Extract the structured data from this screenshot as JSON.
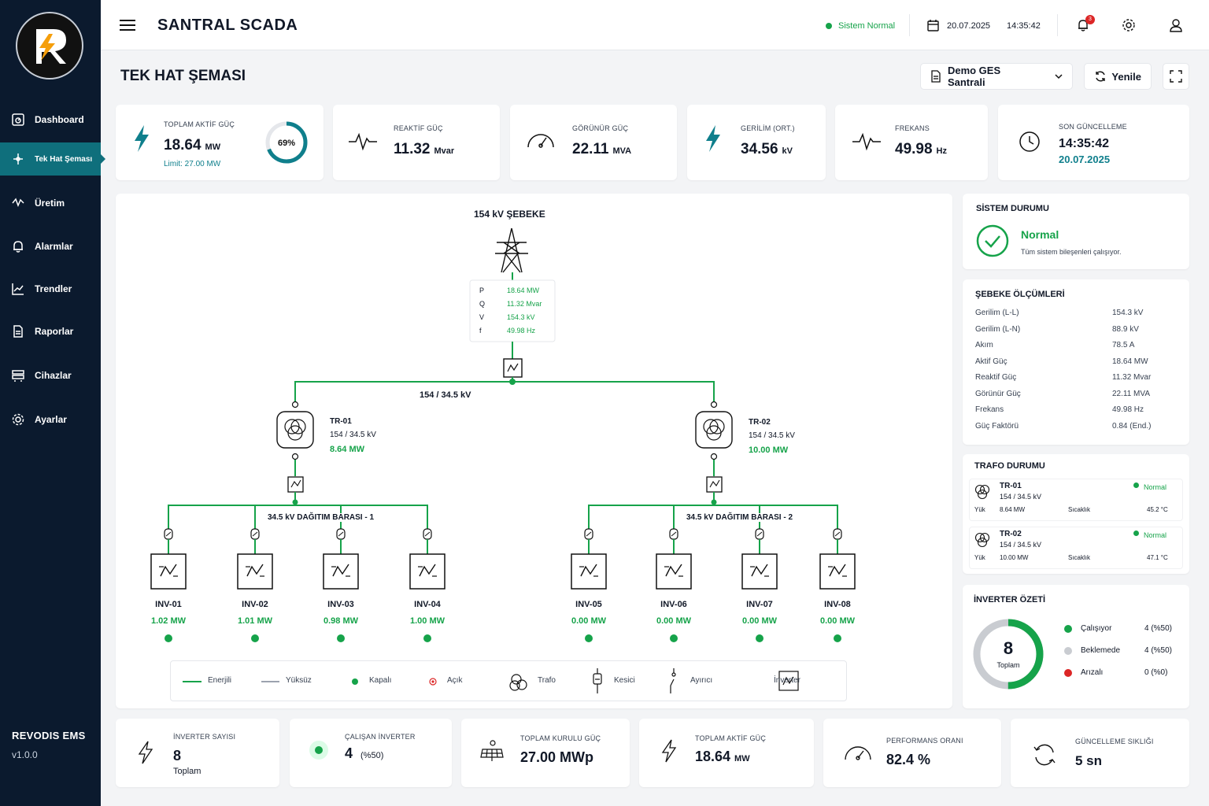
{
  "app": {
    "title": "SANTRAL SCADA",
    "brand": "REVODIS EMS",
    "version": "v1.0.0"
  },
  "status": {
    "label": "Sistem Normal",
    "date": "20.07.2025",
    "time": "14:35:42",
    "notif_count": "3"
  },
  "nav": [
    "Dashboard",
    "Tek Hat Şeması",
    "Üretim",
    "Alarmlar",
    "Trendler",
    "Raporlar",
    "Cihazlar",
    "Ayarlar"
  ],
  "page": {
    "title": "TEK HAT ŞEMASI",
    "plant": "Demo GES Santrali",
    "refresh": "Yenile"
  },
  "kpis": {
    "active_label": "TOPLAM AKTİF GÜÇ",
    "active_value": "18.64",
    "active_unit": "MW",
    "active_limit": "Limit: 27.00 MW",
    "active_pct": "69%",
    "active_fraction": 0.69,
    "reactive_label": "REAKTİF GÜÇ",
    "reactive_value": "11.32",
    "reactive_unit": "Mvar",
    "apparent_label": "GÖRÜNÜR GÜÇ",
    "apparent_value": "22.11",
    "apparent_unit": "MVA",
    "voltage_label": "GERİLİM (ORT.)",
    "voltage_value": "34.56",
    "voltage_unit": "kV",
    "freq_label": "FREKANS",
    "freq_value": "49.98",
    "freq_unit": "Hz",
    "update_label": "SON GÜNCELLEME",
    "update_time": "14:35:42",
    "update_date": "20.07.2025"
  },
  "diagram": {
    "grid_title": "154 kV ŞEBEKE",
    "meter": [
      {
        "k": "P",
        "v": "18.64 MW"
      },
      {
        "k": "Q",
        "v": "11.32 Mvar"
      },
      {
        "k": "V",
        "v": "154.3 kV"
      },
      {
        "k": "f",
        "v": "49.98 Hz"
      }
    ],
    "main_tr": "154 / 34.5 kV",
    "tr1": {
      "name": "TR-01",
      "ratio": "154 / 34.5 kV",
      "power": "8.64 MW"
    },
    "tr2": {
      "name": "TR-02",
      "ratio": "154 / 34.5 kV",
      "power": "10.00 MW"
    },
    "bus1": "34.5 kV DAĞITIM BARASI - 1",
    "bus2": "34.5 kV DAĞITIM BARASI - 2",
    "inverters": [
      {
        "name": "INV-01",
        "power": "1.02 MW"
      },
      {
        "name": "INV-02",
        "power": "1.01 MW"
      },
      {
        "name": "INV-03",
        "power": "0.98 MW"
      },
      {
        "name": "INV-04",
        "power": "1.00 MW"
      },
      {
        "name": "INV-05",
        "power": "0.00 MW"
      },
      {
        "name": "INV-06",
        "power": "0.00 MW"
      },
      {
        "name": "INV-07",
        "power": "0.00 MW"
      },
      {
        "name": "INV-08",
        "power": "0.00 MW"
      }
    ],
    "legend": [
      "Enerjili",
      "Yüksüz",
      "Kapalı",
      "Açık",
      "Trafo",
      "Kesici",
      "Ayırıcı",
      "İnverter"
    ]
  },
  "system": {
    "title": "SİSTEM DURUMU",
    "state": "Normal",
    "desc": "Tüm sistem bileşenleri çalışıyor."
  },
  "grid_meas": {
    "title": "ŞEBEKE ÖLÇÜMLERİ",
    "rows": [
      {
        "k": "Gerilim (L-L)",
        "v": "154.3 kV"
      },
      {
        "k": "Gerilim (L-N)",
        "v": "88.9 kV"
      },
      {
        "k": "Akım",
        "v": "78.5 A"
      },
      {
        "k": "Aktif Güç",
        "v": "18.64 MW"
      },
      {
        "k": "Reaktif Güç",
        "v": "11.32 Mvar"
      },
      {
        "k": "Görünür Güç",
        "v": "22.11 MVA"
      },
      {
        "k": "Frekans",
        "v": "49.98 Hz"
      },
      {
        "k": "Güç Faktörü",
        "v": "0.84 (End.)"
      }
    ]
  },
  "trafo": {
    "title": "TRAFO DURUMU",
    "load": "Yük",
    "temp_label": "Sıcaklık",
    "items": [
      {
        "name": "TR-01",
        "ratio": "154 / 34.5 kV",
        "status": "Normal",
        "load": "8.64 MW",
        "temp": "45.2 °C"
      },
      {
        "name": "TR-02",
        "ratio": "154 / 34.5 kV",
        "status": "Normal",
        "load": "10.00 MW",
        "temp": "47.1 °C"
      }
    ]
  },
  "inv_summary": {
    "title": "İNVERTER ÖZETİ",
    "total": "8",
    "total_label": "Toplam",
    "fraction_running": 0.5,
    "rows": [
      {
        "k": "Çalışıyor",
        "v": "4 (%50)",
        "color": "#16a34a"
      },
      {
        "k": "Beklemede",
        "v": "4 (%50)",
        "color": "#c9ccd1"
      },
      {
        "k": "Arızalı",
        "v": "0 (%0)",
        "color": "#dc2626"
      }
    ]
  },
  "bottom": {
    "inv_count_label": "İNVERTER SAYISI",
    "inv_count": "8",
    "inv_count_sub": "Toplam",
    "running_label": "ÇALIŞAN İNVERTER",
    "running": "4",
    "running_pct": "(%50)",
    "installed_label": "TOPLAM KURULU GÜÇ",
    "installed": "27.00 MWp",
    "active_label": "TOPLAM AKTİF GÜÇ",
    "active": "18.64",
    "active_unit": "MW",
    "perf_label": "PERFORMANS ORANI",
    "perf": "82.4 %",
    "freq_label": "GÜNCELLEME SIKLIĞI",
    "freq": "5 sn"
  },
  "colors": {
    "green": "#16a34a",
    "teal": "#0f7f8c",
    "navy": "#0b1a2e"
  }
}
